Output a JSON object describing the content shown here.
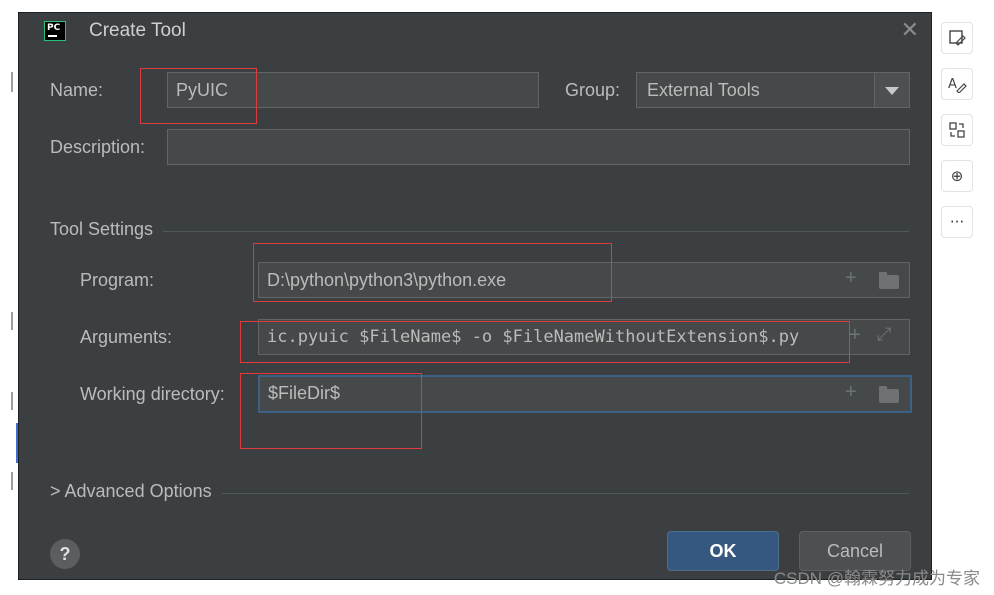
{
  "dialog": {
    "title": "Create Tool",
    "name_label": "Name:",
    "name_value": "PyUIC",
    "group_label": "Group:",
    "group_value": "External Tools",
    "description_label": "Description:",
    "description_value": "",
    "tool_settings_title": "Tool Settings",
    "program_label": "Program:",
    "program_value": "D:\\python\\python3\\python.exe",
    "arguments_label": "Arguments:",
    "arguments_value": "ic.pyuic $FileName$ -o $FileNameWithoutExtension$.py",
    "working_dir_label": "Working directory:",
    "working_dir_value": "$FileDir$",
    "advanced_label": "> Advanced Options",
    "help_label": "?",
    "ok_label": "OK",
    "cancel_label": "Cancel",
    "plus_glyph": "+",
    "expand_glyph": "⤢"
  },
  "right_toolbar": {
    "icons": [
      "image-edit-icon",
      "text-edit-icon",
      "compare-icon",
      "zoom-in-icon",
      "more-icon"
    ],
    "more_label": "···",
    "zoom_glyph": "⊕"
  },
  "watermark": "CSDN @翰霖努力成为专家",
  "colors": {
    "dialog_bg": "#3c3f41",
    "field_bg": "#45494a",
    "ok_button": "#365880",
    "annotation_red": "#e03a3a",
    "focus_border": "#3d6185"
  }
}
